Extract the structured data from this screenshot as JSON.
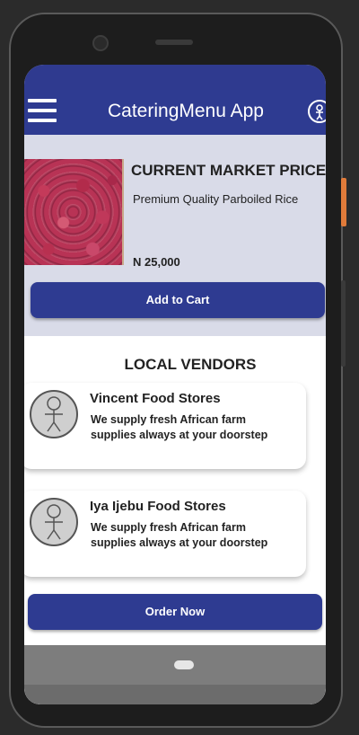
{
  "app": {
    "title": "CateringMenu App"
  },
  "icons": {
    "menu": "hamburger-menu-icon",
    "profile": "person-icon",
    "avatar": "person-icon"
  },
  "colors": {
    "primary": "#2e3b91",
    "product_bg": "#d9dbe8",
    "card_bg": "#ffffff"
  },
  "product": {
    "heading": "CURRENT MARKET PRICE",
    "description": "Premium Quality Parboiled Rice",
    "price": "N 25,000",
    "add_to_cart_label": "Add to Cart"
  },
  "vendors": {
    "title": "LOCAL VENDORS",
    "items": [
      {
        "name": "Vincent Food Stores",
        "description": "We supply fresh African farm supplies always at your doorstep"
      },
      {
        "name": "Iya Ijebu Food Stores",
        "description": "We supply fresh African farm supplies always at your doorstep"
      }
    ],
    "order_now_label": "Order Now"
  }
}
